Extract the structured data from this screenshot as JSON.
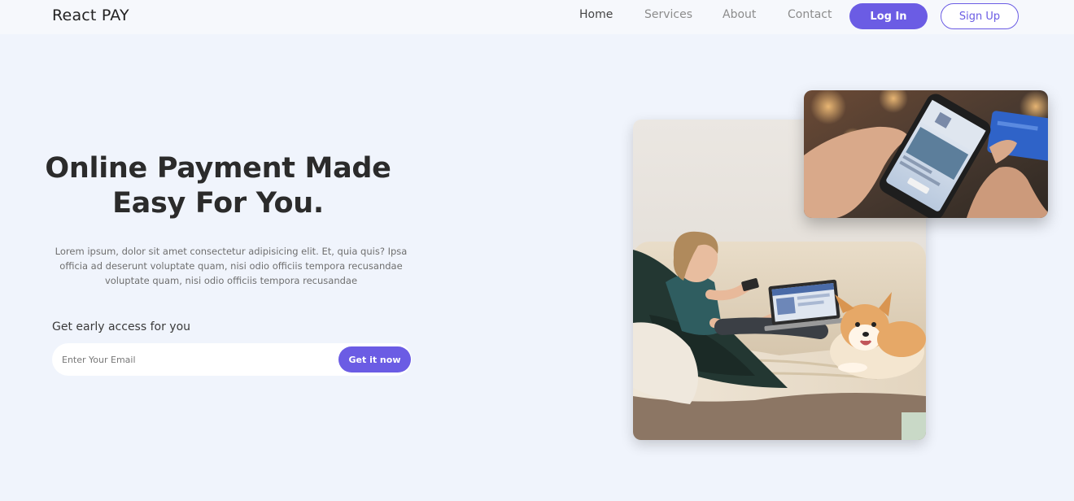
{
  "nav": {
    "brand": "React PAY",
    "links": [
      "Home",
      "Services",
      "About",
      "Contact"
    ],
    "login_label": "Log In",
    "signup_label": "Sign Up"
  },
  "hero": {
    "title_line1": "Online Payment Made",
    "title_line2": "Easy For You.",
    "description_line1": "Lorem ipsum, dolor sit amet consectetur adipisicing elit. Et, quia quis? Ipsa",
    "description_line2": "officia ad deserunt voluptate quam, nisi odio officiis tempora recusandae",
    "description_line3": "voluptate quam, nisi odio officiis tempora recusandae",
    "early_access_label": "Get early access for you",
    "email_placeholder": "Enter Your Email",
    "cta_label": "Get it now"
  },
  "colors": {
    "accent": "#6b5ce4",
    "background": "#f0f4fc",
    "nav_background": "#f6f8fc"
  }
}
